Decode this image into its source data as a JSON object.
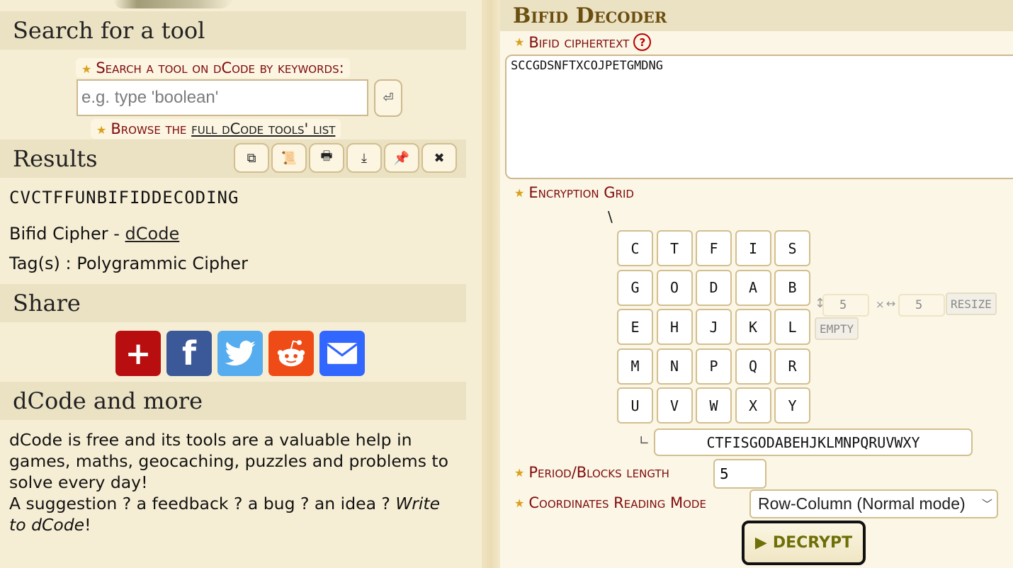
{
  "left": {
    "search": {
      "heading": "Search for a tool",
      "label": "Search a tool on dCode by keywords:",
      "placeholder": "e.g. type 'boolean'",
      "value": "",
      "go_icon": "return-icon",
      "go_glyph": "⏎",
      "browse_prefix": "Browse the",
      "browse_link": "full dCode tools' list"
    },
    "results": {
      "heading": "Results",
      "buttons": [
        {
          "name": "copy",
          "icon": "copy-icon",
          "glyph": "⧉"
        },
        {
          "name": "scroll",
          "icon": "scroll-icon",
          "glyph": "📜"
        },
        {
          "name": "print",
          "icon": "print-icon",
          "glyph": "🖶"
        },
        {
          "name": "download",
          "icon": "download-icon",
          "glyph": "⤓"
        },
        {
          "name": "pin",
          "icon": "pin-icon",
          "glyph": "📌"
        },
        {
          "name": "close",
          "icon": "close-icon",
          "glyph": "✖"
        }
      ],
      "value": "CVCTFFUNBIFIDDECODING",
      "title_prefix": "Bifid Cipher -",
      "title_link": "dCode",
      "tags": "Tag(s) : Polygrammic Cipher"
    },
    "share": {
      "heading": "Share",
      "buttons": [
        {
          "name": "share-more",
          "icon": "plus-icon",
          "glyph": "+",
          "color": "#b90e10"
        },
        {
          "name": "facebook",
          "icon": "facebook-icon",
          "glyph": "f",
          "color": "#3b5998"
        },
        {
          "name": "twitter",
          "icon": "twitter-icon",
          "glyph": "🐦",
          "color": "#55acee"
        },
        {
          "name": "reddit",
          "icon": "reddit-icon",
          "glyph": "👽",
          "color": "#ef4b16"
        },
        {
          "name": "email",
          "icon": "email-icon",
          "glyph": "✉",
          "color": "#3166ff"
        }
      ]
    },
    "more": {
      "heading": "dCode and more",
      "text1": "dCode is free and its tools are a valuable help in games, maths, geocaching, puzzles and problems to solve every day!",
      "text2": "A suggestion ? a feedback ? a bug ? an idea ?",
      "link": "Write to dCode",
      "link_a": "Write to ",
      "link_b": "dCode",
      "suffix": "!"
    }
  },
  "tool": {
    "title": "Bifid Decoder",
    "cipher_label": "Bifid ciphertext",
    "help_glyph": "?",
    "ciphertext": "SCCGDSNFTXCOJPETGMDNG",
    "grid_label": "Encryption Grid",
    "grid_corner": "\\",
    "grid": [
      [
        "C",
        "T",
        "F",
        "I",
        "S"
      ],
      [
        "G",
        "O",
        "D",
        "A",
        "B"
      ],
      [
        "E",
        "H",
        "J",
        "K",
        "L"
      ],
      [
        "M",
        "N",
        "P",
        "Q",
        "R"
      ],
      [
        "U",
        "V",
        "W",
        "X",
        "Y"
      ]
    ],
    "rows": "5",
    "cols": "5",
    "rows_icon": "↕",
    "times": "×",
    "cols_icon": "↔",
    "resize_label": "RESIZE",
    "empty_label": "EMPTY",
    "key_corner": "∟",
    "key": "CTFISGODABEHJKLMNPQRUVWXY",
    "period_label": "Period/Blocks length",
    "period": "5",
    "mode_label": "Coordinates Reading Mode",
    "mode_selected": "Row-Column (Normal mode)",
    "decrypt_label": "DECRYPT",
    "decrypt_glyph": "▶"
  },
  "colors": {
    "label_red": "#7f0b0b",
    "star": "#d9a11b",
    "title_brown": "#6b4f10",
    "decrypt_olive": "#6f6f08"
  }
}
